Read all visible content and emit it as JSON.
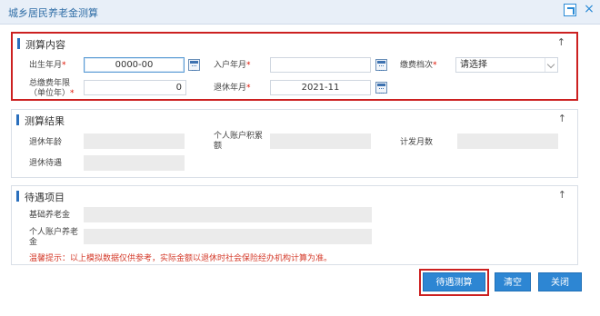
{
  "dialog": {
    "title": "城乡居民养老金测算"
  },
  "calc_content": {
    "heading": "测算内容",
    "birth_label": "出生年月",
    "birth_value": "0000-00",
    "entry_label": "入户年月",
    "entry_value": "",
    "grade_label": "缴费档次",
    "grade_value": "请选择",
    "years_label_line1": "总缴费年限",
    "years_label_line2": "（单位年）",
    "years_value": "0",
    "retire_label": "退休年月",
    "retire_value": "2021-11",
    "required_mark": "*"
  },
  "calc_result": {
    "heading": "测算结果",
    "retire_age_label": "退休年龄",
    "account_label_line1": "个人账户积累",
    "account_label_line2": "额",
    "months_label": "计发月数",
    "benefit_label": "退休待遇"
  },
  "benefit_items": {
    "heading": "待遇项目",
    "basic_label": "基础养老金",
    "personal_label_line1": "个人账户养老",
    "personal_label_line2": "金"
  },
  "notice": "温馨提示：以上模拟数据仅供参考，实际金额以退休时社会保险经办机构计算为准。",
  "buttons": {
    "calc": "待遇测算",
    "clear": "清空",
    "close": "关闭"
  },
  "collapse_glyph": "↑",
  "colors": {
    "accent": "#2d86d3",
    "highlight": "#cc2020",
    "notice": "#d43a2a"
  }
}
